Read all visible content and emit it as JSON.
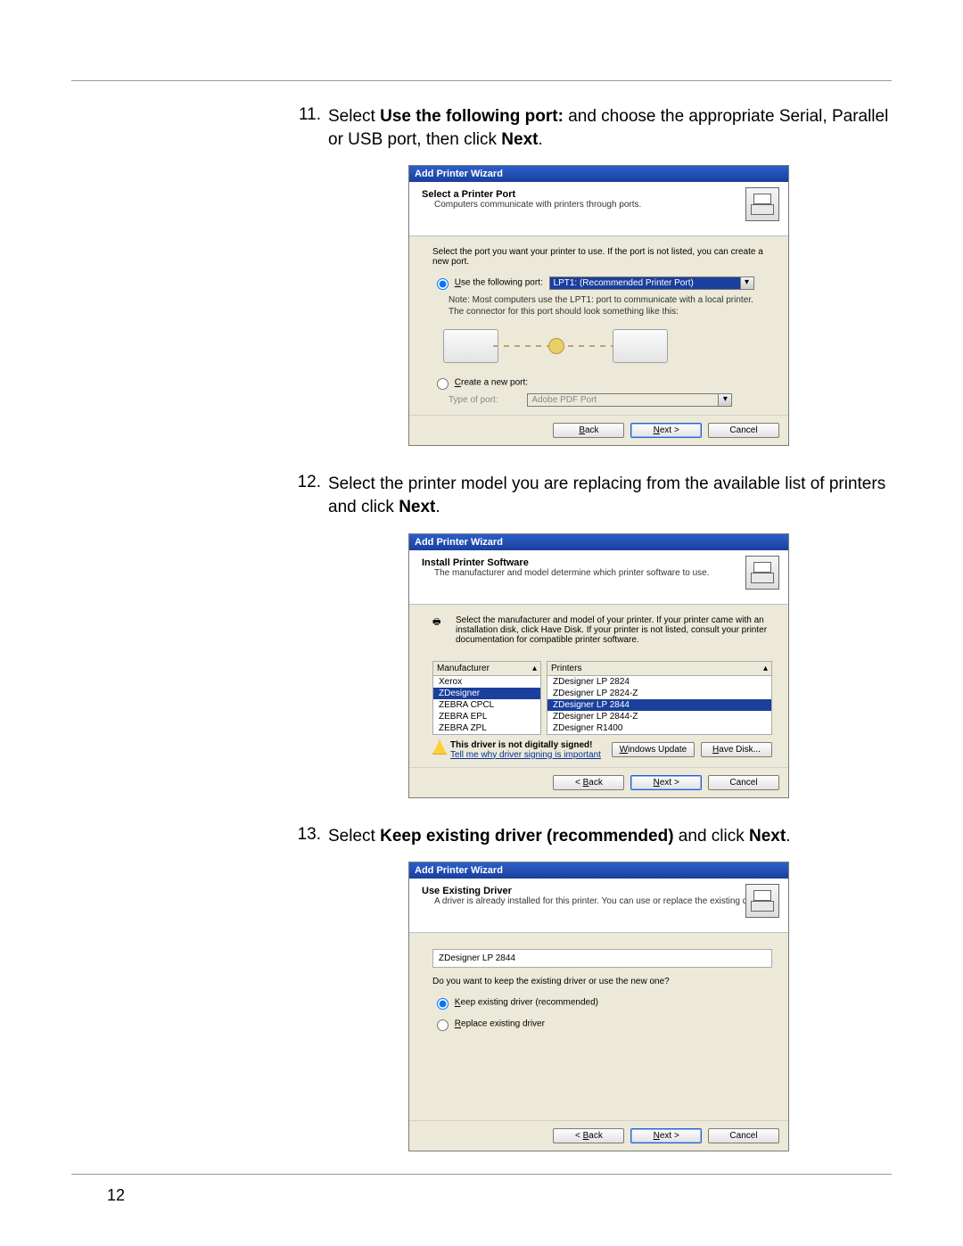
{
  "page_number": "12",
  "steps": {
    "s11": {
      "num": "11.",
      "pre": "Select ",
      "b1": "Use the following port:",
      "mid": " and choose the appropriate Serial, Parallel or USB port, then click ",
      "b2": "Next",
      "post": "."
    },
    "s12": {
      "num": "12.",
      "pre": "Select the printer model you are replacing from the available list of printers and click ",
      "b1": "Next",
      "post": "."
    },
    "s13": {
      "num": "13.",
      "pre": "Select ",
      "b1": "Keep existing driver (recommended)",
      "mid": " and click ",
      "b2": "Next",
      "post": "."
    }
  },
  "dlg1": {
    "title": "Add Printer Wizard",
    "heading": "Select a Printer Port",
    "sub": "Computers communicate with printers through ports.",
    "intro": "Select the port you want your printer to use. If the port is not listed, you can create a new port.",
    "opt_use_prefix": "U",
    "opt_use": "se the following port:",
    "port_value": "LPT1: (Recommended Printer Port)",
    "hint1": "Note: Most computers use the LPT1: port to communicate with a local printer.",
    "hint2": "The connector for this port should look something like this:",
    "opt_create_prefix": "C",
    "opt_create": "reate a new port:",
    "type_label": "Type of port:",
    "type_value": "Adobe PDF Port",
    "btn_back": "< Back",
    "btn_next": "Next >",
    "btn_cancel": "Cancel"
  },
  "dlg2": {
    "title": "Add Printer Wizard",
    "heading": "Install Printer Software",
    "sub": "The manufacturer and model determine which printer software to use.",
    "intro": "Select the manufacturer and model of your printer. If your printer came with an installation disk, click Have Disk. If your printer is not listed, consult your printer documentation for compatible printer software.",
    "col_manu": "Manufacturer",
    "col_prn": "Printers",
    "manu": [
      "Xerox",
      "ZDesigner",
      "ZEBRA CPCL",
      "ZEBRA EPL",
      "ZEBRA ZPL"
    ],
    "manu_sel": "ZDesigner",
    "prn": [
      "ZDesigner LP 2824",
      "ZDesigner LP 2824-Z",
      "ZDesigner LP 2844",
      "ZDesigner LP 2844-Z",
      "ZDesigner R1400"
    ],
    "prn_sel": "ZDesigner LP 2844",
    "warn_bold": "This driver is not digitally signed!",
    "warn_link": "Tell me why driver signing is important",
    "btn_wu_prefix": "W",
    "btn_wu": "indows Update",
    "btn_hd_prefix": "H",
    "btn_hd": "ave Disk...",
    "btn_back": "< Back",
    "btn_next": "Next >",
    "btn_cancel": "Cancel"
  },
  "dlg3": {
    "title": "Add Printer Wizard",
    "heading": "Use Existing Driver",
    "sub": "A driver is already installed for this printer. You can use or replace the existing driver.",
    "driver": "ZDesigner LP 2844",
    "q": "Do you want to keep the existing driver or use the new one?",
    "opt_keep_prefix": "K",
    "opt_keep": "eep existing driver (recommended)",
    "opt_repl_prefix": "R",
    "opt_repl": "eplace existing driver",
    "btn_back": "< Back",
    "btn_next": "Next >",
    "btn_cancel": "Cancel"
  }
}
